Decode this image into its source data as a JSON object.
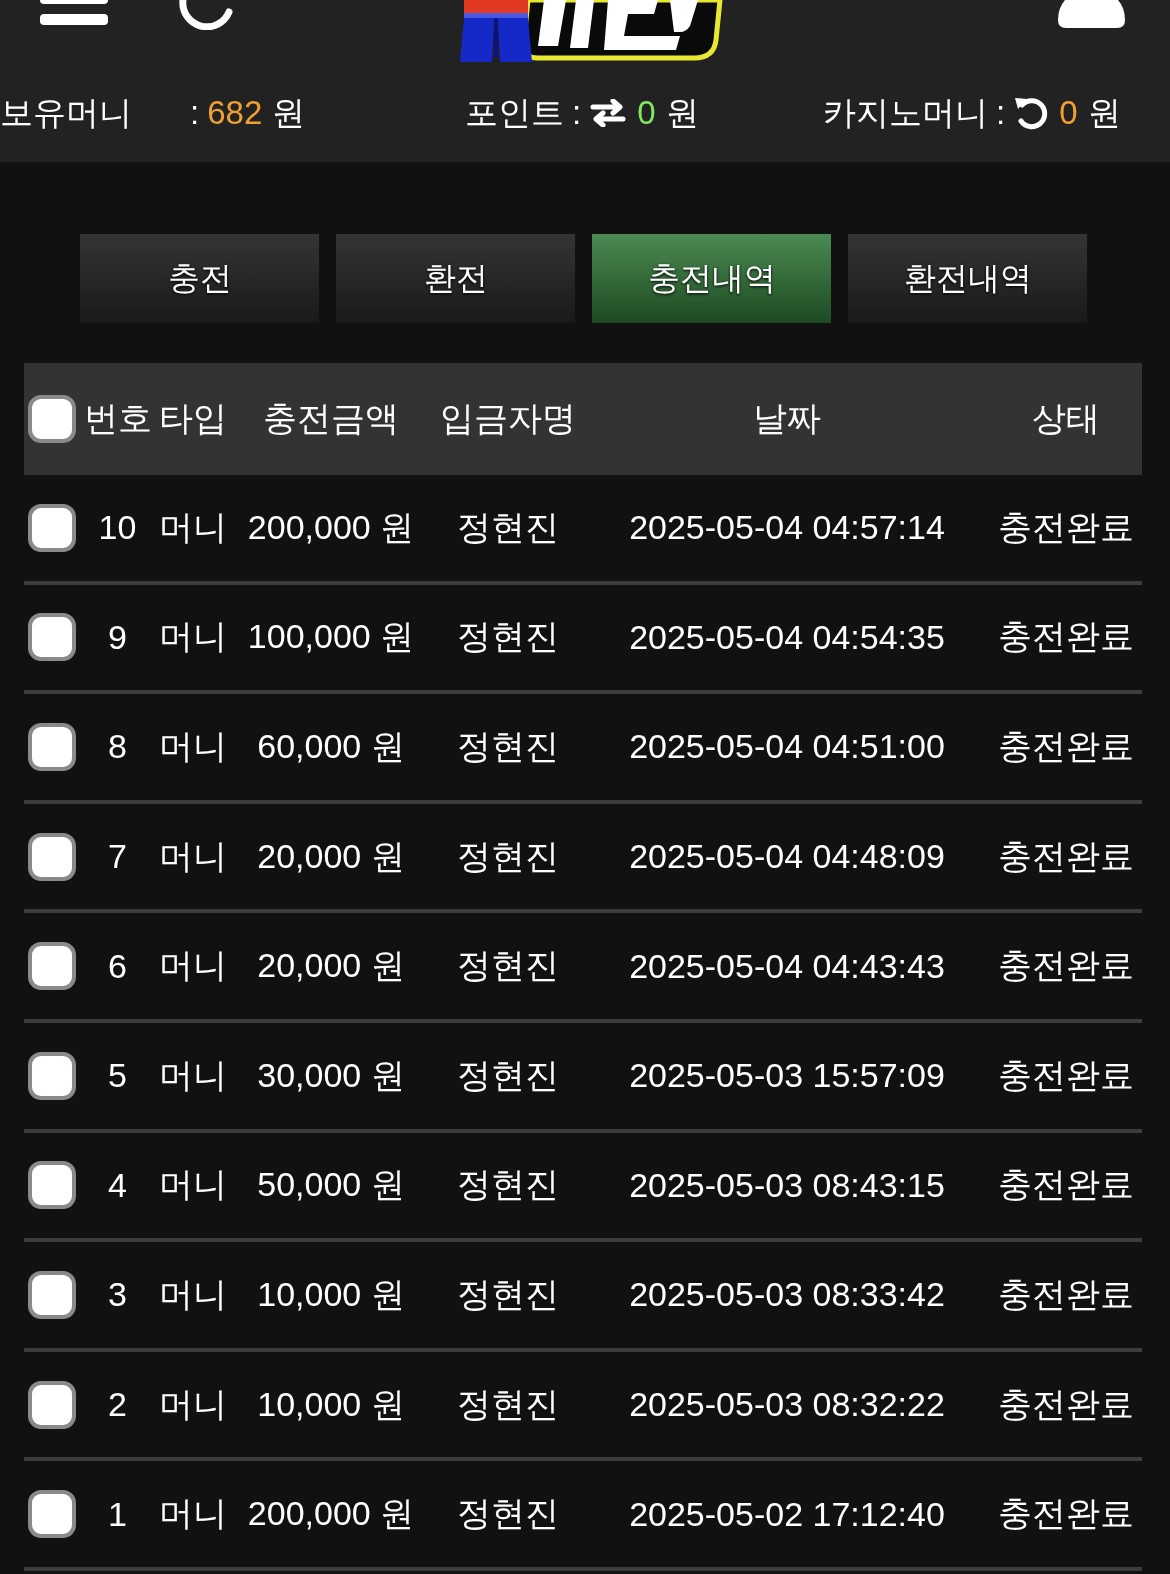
{
  "balances": [
    {
      "kind": "money",
      "label": "보유머니",
      "colon": ":",
      "value": "682",
      "unit": "원",
      "color": "#f0a030"
    },
    {
      "kind": "points",
      "label": "포인트",
      "colon": ":",
      "value": "0",
      "unit": "원",
      "color": "#80e860"
    },
    {
      "kind": "casino",
      "label": "카지노머니",
      "colon": ":",
      "value": "0",
      "unit": "원",
      "color": "#f0a030"
    }
  ],
  "tabs": [
    {
      "label": "충전",
      "selected": false
    },
    {
      "label": "환전",
      "selected": false
    },
    {
      "label": "충전내역",
      "selected": true
    },
    {
      "label": "환전내역",
      "selected": false
    }
  ],
  "table": {
    "select_all": {
      "checked": false
    },
    "columns": [
      "번호",
      "타입",
      "충전금액",
      "입금자명",
      "날짜",
      "상태"
    ],
    "rows": [
      {
        "checked": false,
        "number": "10",
        "type": "머니",
        "amount": "200,000 원",
        "depositor": "정현진",
        "date": "2025-05-04 04:57:14",
        "status": "충전완료"
      },
      {
        "checked": false,
        "number": "9",
        "type": "머니",
        "amount": "100,000 원",
        "depositor": "정현진",
        "date": "2025-05-04 04:54:35",
        "status": "충전완료"
      },
      {
        "checked": false,
        "number": "8",
        "type": "머니",
        "amount": "60,000 원",
        "depositor": "정현진",
        "date": "2025-05-04 04:51:00",
        "status": "충전완료"
      },
      {
        "checked": false,
        "number": "7",
        "type": "머니",
        "amount": "20,000 원",
        "depositor": "정현진",
        "date": "2025-05-04 04:48:09",
        "status": "충전완료"
      },
      {
        "checked": false,
        "number": "6",
        "type": "머니",
        "amount": "20,000 원",
        "depositor": "정현진",
        "date": "2025-05-04 04:43:43",
        "status": "충전완료"
      },
      {
        "checked": false,
        "number": "5",
        "type": "머니",
        "amount": "30,000 원",
        "depositor": "정현진",
        "date": "2025-05-03 15:57:09",
        "status": "충전완료"
      },
      {
        "checked": false,
        "number": "4",
        "type": "머니",
        "amount": "50,000 원",
        "depositor": "정현진",
        "date": "2025-05-03 08:43:15",
        "status": "충전완료"
      },
      {
        "checked": false,
        "number": "3",
        "type": "머니",
        "amount": "10,000 원",
        "depositor": "정현진",
        "date": "2025-05-03 08:33:42",
        "status": "충전완료"
      },
      {
        "checked": false,
        "number": "2",
        "type": "머니",
        "amount": "10,000 원",
        "depositor": "정현진",
        "date": "2025-05-03 08:32:22",
        "status": "충전완료"
      },
      {
        "checked": false,
        "number": "1",
        "type": "머니",
        "amount": "200,000 원",
        "depositor": "정현진",
        "date": "2025-05-02 17:12:40",
        "status": "충전완료"
      }
    ]
  }
}
